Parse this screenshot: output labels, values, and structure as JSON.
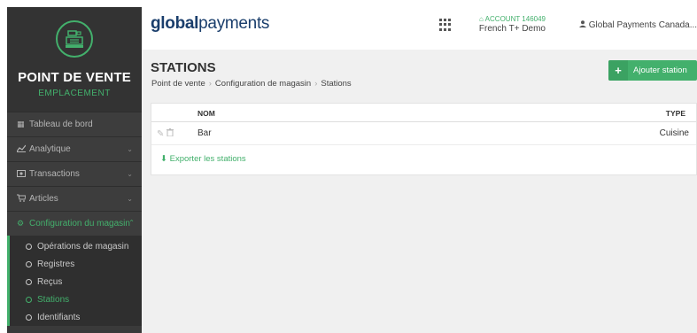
{
  "sidebar": {
    "brand_title": "POINT DE VENTE",
    "brand_subtitle": "EMPLACEMENT",
    "items": [
      {
        "label": "Tableau de bord",
        "icon": "dashboard-icon"
      },
      {
        "label": "Analytique",
        "icon": "chart-icon"
      },
      {
        "label": "Transactions",
        "icon": "money-icon"
      },
      {
        "label": "Articles",
        "icon": "cart-icon"
      },
      {
        "label": "Configuration du magasin",
        "icon": "cogs-icon"
      }
    ],
    "submenu": [
      {
        "label": "Opérations de magasin"
      },
      {
        "label": "Registres"
      },
      {
        "label": "Reçus"
      },
      {
        "label": "Stations"
      },
      {
        "label": "Identifiants"
      }
    ]
  },
  "header": {
    "logo_bold": "global",
    "logo_light": "payments",
    "account_id": "ACCOUNT 146049",
    "account_name": "French T+ Demo",
    "user": "Global Payments Canada..."
  },
  "main": {
    "title": "STATIONS",
    "breadcrumb": [
      "Point de vente",
      "Configuration de magasin",
      "Stations"
    ],
    "add_button": "Ajouter station",
    "table": {
      "col_name": "NOM",
      "col_type": "TYPE",
      "rows": [
        {
          "name": "Bar",
          "type": "Cuisine"
        }
      ]
    },
    "export_link": "Exporter les stations"
  },
  "colors": {
    "accent": "#43b06c",
    "sidebar": "#3a3a3a",
    "brand_blue": "#1a3e6c"
  }
}
